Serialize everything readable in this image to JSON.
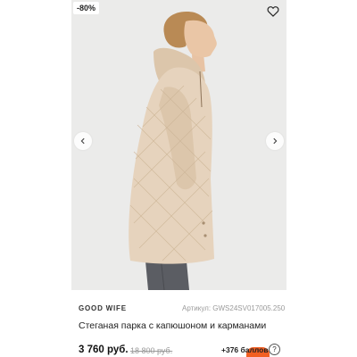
{
  "product": {
    "discount_badge": "-80%",
    "brand": "GOOD WIFE",
    "article": "Артикул: GWS24SV017005.250",
    "title": "Стеганая парка с капюшоном и карманами",
    "price": "3 760 руб.",
    "old_price": "18 800 руб.",
    "bonus": "+376 баллов",
    "help": "?"
  },
  "icons": {
    "favorite": "heart-outline-icon",
    "prev": "chevron-left-icon",
    "next": "chevron-right-icon"
  },
  "colors": {
    "accent": "#f25f22",
    "photo_background": "#ebebea",
    "coat": "#e6d3bd"
  }
}
